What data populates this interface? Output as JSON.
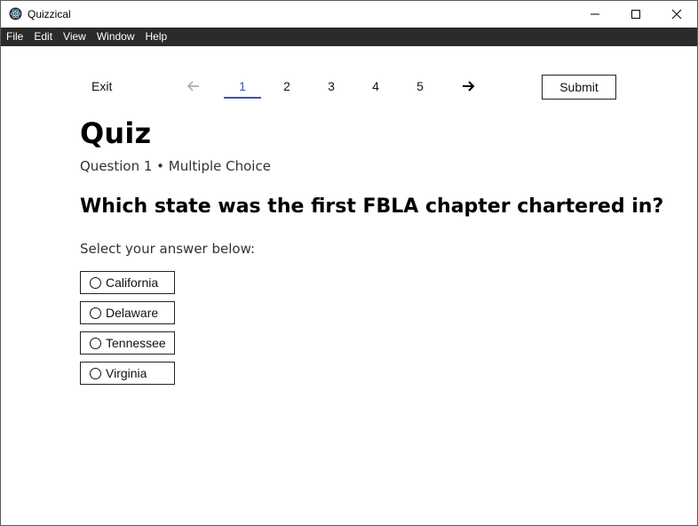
{
  "window": {
    "title": "Quizzical",
    "icon": "electron-atom-icon",
    "controls": [
      "minimize-icon",
      "maximize-icon",
      "close-icon"
    ]
  },
  "menubar": {
    "items": [
      "File",
      "Edit",
      "View",
      "Window",
      "Help"
    ]
  },
  "nav": {
    "exit_label": "Exit",
    "prev_icon": "arrow-left-icon",
    "next_icon": "arrow-right-icon",
    "pages": [
      "1",
      "2",
      "3",
      "4",
      "5"
    ],
    "current_page": "1",
    "submit_label": "Submit"
  },
  "quiz": {
    "title": "Quiz",
    "subtitle": "Question 1 • Multiple Choice",
    "question": "Which state was the first FBLA chapter chartered in?",
    "instruction": "Select your answer below:",
    "options": [
      "California",
      "Delaware",
      "Tennessee",
      "Virginia"
    ]
  },
  "colors": {
    "menubar_bg": "#2b2b2b",
    "active_page": "#3f51b5",
    "disabled_arrow": "#b0b0b0"
  }
}
